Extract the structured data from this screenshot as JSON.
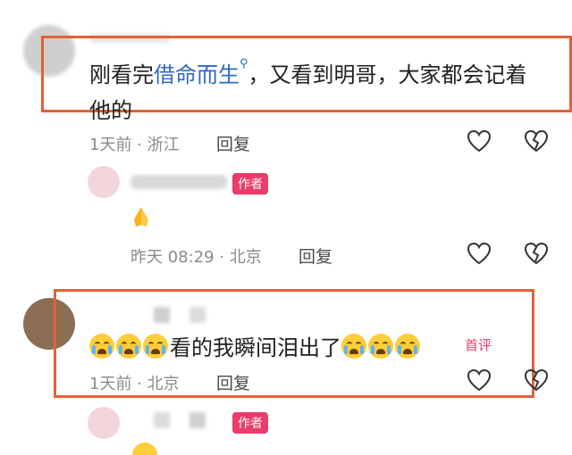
{
  "comments": [
    {
      "text_pre": "刚看完",
      "link": "借命而生",
      "text_line1_post": "，又看到明哥，大家都会记着",
      "text_line2": "他的",
      "meta": "1天前 · 浙江",
      "reply_label": "回复"
    },
    {
      "text": "看的我瞬间泪出了",
      "badge": "首评",
      "meta": "1天前 · 北京",
      "reply_label": "回复"
    }
  ],
  "replies": [
    {
      "author_tag": "作者",
      "meta": "昨天 08:29 · 北京",
      "reply_label": "回复"
    },
    {
      "author_tag": "作者"
    }
  ],
  "colors": {
    "highlight_border": "#e0623a",
    "author_tag": "#ea3c6a",
    "link": "#2f69c6"
  }
}
